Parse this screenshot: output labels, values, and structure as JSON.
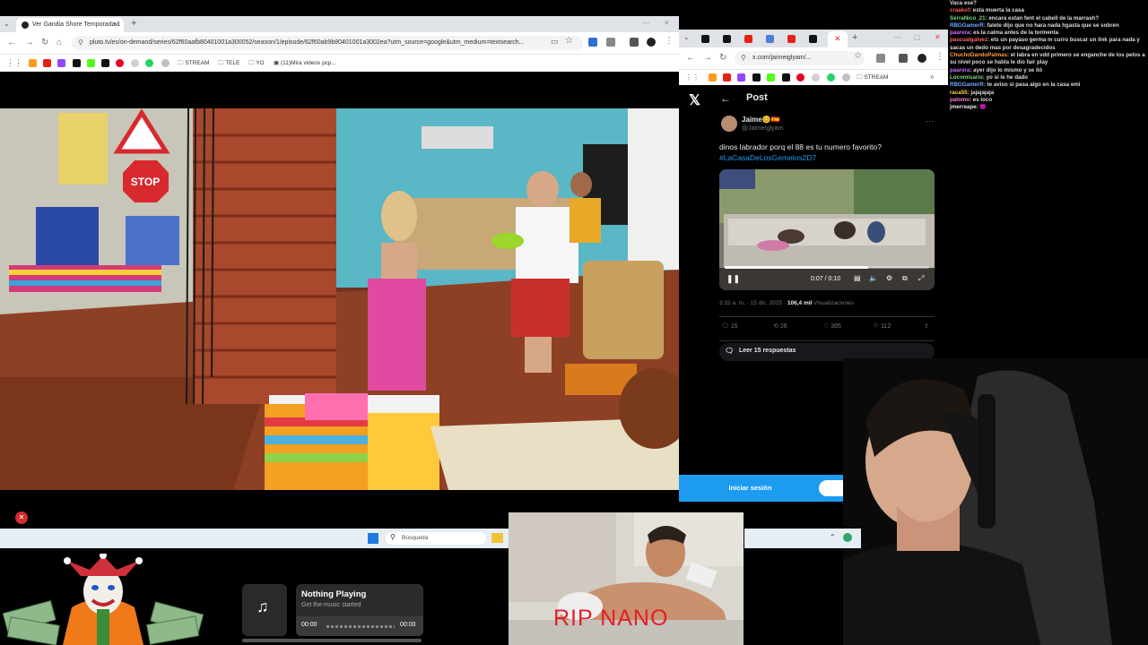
{
  "left_browser": {
    "tab_title": "Ver Gandia Shore Temporada 1",
    "url": "pluto.tv/es/on-demand/series/62f60aafb80401001a300052/season/1/episode/62f60ab9b80401001a3002ea?utm_source=google&utm_medium=textsearch...",
    "bookmarks": [
      "STREAM",
      "TELE",
      "YO",
      "(11)Mira videos pcp..."
    ]
  },
  "right_browser": {
    "url": "x.com/jaimeiglyam/...",
    "bookmarks": [
      "STREAM"
    ]
  },
  "tweet": {
    "header_title": "Post",
    "author_name": "Jaime😊🇪🇸",
    "author_handle": "@JaimeIglyam",
    "text": "dinos labrador porq el 88 es tu numero favorito?",
    "hashtag": "#LaCasaDeLosGemelos2D7",
    "video_time": "0:07 / 0:10",
    "meta_time": "3:15 a. m. · 15 dic. 2025 ·",
    "views_count": "106,4 mil",
    "views_label": "Visualizaciones",
    "replies": "15",
    "retweets": "26",
    "likes": "395",
    "bookmarks": "112",
    "read_replies": "Leer 15 respuestas",
    "login_button": "Iniciar sesión",
    "progress": 0.7
  },
  "chat": [
    {
      "user": "",
      "msg": "Vaca ese?",
      "color": "#e8e8e8"
    },
    {
      "user": "craakof",
      "msg": "esta muerta la casa",
      "color": "#ff5a5a"
    },
    {
      "user": "SerraNico_21",
      "msg": "encara estan fent el cabell de la marrash?",
      "color": "#7fd67f"
    },
    {
      "user": "RBGGamerR",
      "msg": "falete dijo que no hara nada hgasta que se sobren",
      "color": "#6fa8ff"
    },
    {
      "user": "paarera",
      "msg": "es la calma antes de la tormenta",
      "color": "#d46bff"
    },
    {
      "user": "pascualgalvez",
      "msg": "ets un payaso germa m curro buscar un link para nada y",
      "color": "#ff6b6b"
    },
    {
      "user": "",
      "msg": "sacas un dedo mas por desagradecidos",
      "color": "#e8e8e8"
    },
    {
      "user": "ChuchoDandoPalmas",
      "msg": "el labra en vdd primero se enganche de los pelos a",
      "color": "#ff9f43"
    },
    {
      "user": "",
      "msg": "su nivel poco se habla le dio fair play",
      "color": "#e8e8e8"
    },
    {
      "user": "paarera",
      "msg": "ayer dijo lo mismo y se lió",
      "color": "#d46bff"
    },
    {
      "user": "Locomisario",
      "msg": "yo si le he dado",
      "color": "#7fd67f"
    },
    {
      "user": "RBGGamerR",
      "msg": "te aviso si pasa algo en la casa emi",
      "color": "#6fa8ff"
    },
    {
      "user": "raca55",
      "msg": "jajajajaja",
      "color": "#ffd84d"
    },
    {
      "user": "palomo",
      "msg": "es loco",
      "color": "#ff7ad9"
    },
    {
      "user": "jmerreape",
      "msg": "😈",
      "color": "#e8e8e8"
    }
  ],
  "taskbar": {
    "search_placeholder": "Búsqueda"
  },
  "music_widget": {
    "title": "Nothing Playing",
    "subtitle": "Get the music started",
    "time_start": "00:00",
    "time_end": "00:00"
  },
  "overlay_text": "RIP NANO"
}
